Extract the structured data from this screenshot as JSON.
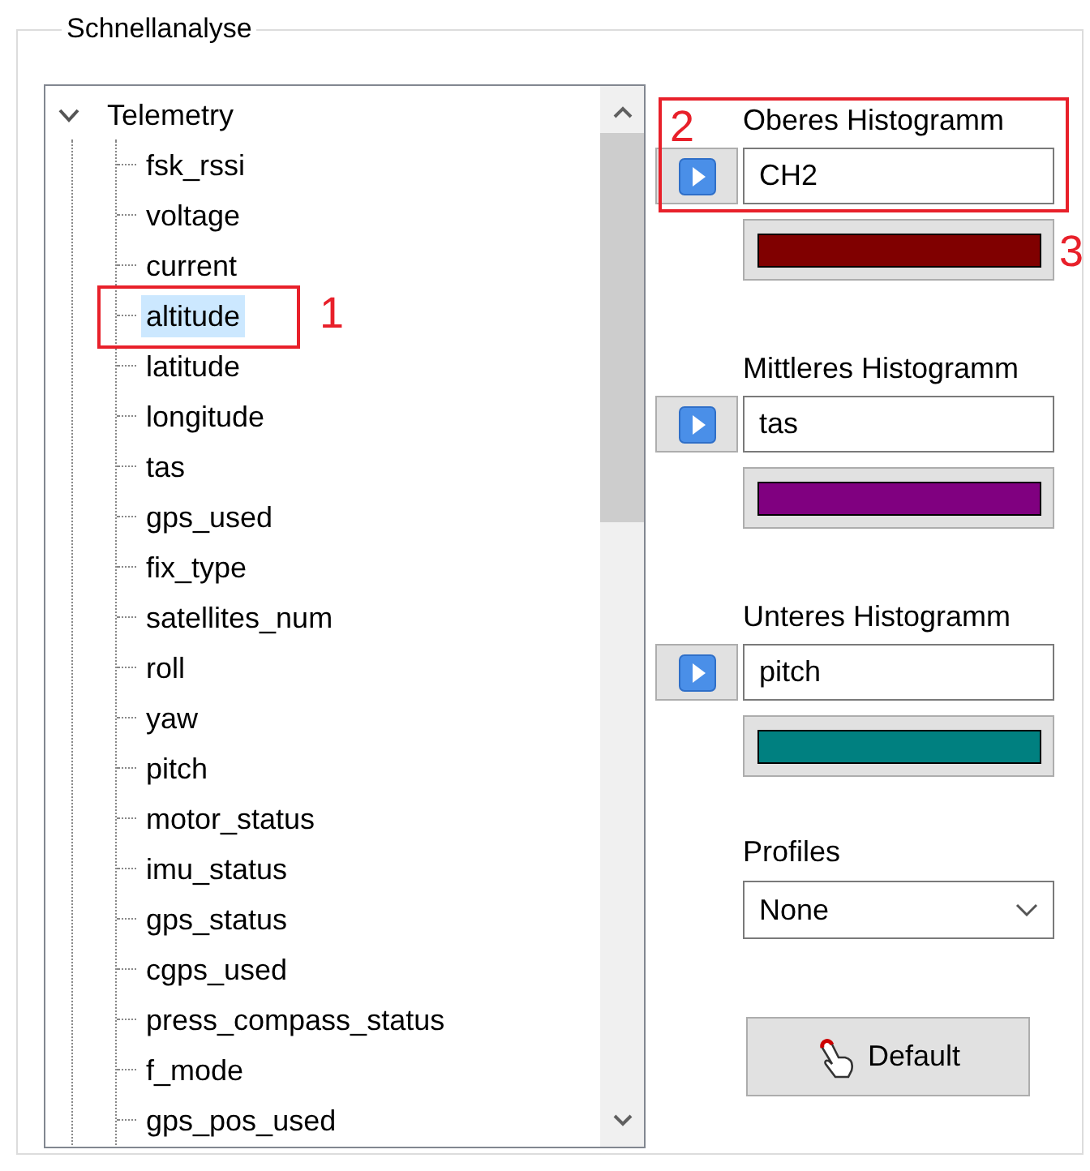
{
  "group_title": "Schnellanalyse",
  "tree": {
    "label": "Telemetry",
    "expanded": true,
    "children": [
      {
        "label": "fsk_rssi",
        "selected": false
      },
      {
        "label": "voltage",
        "selected": false
      },
      {
        "label": "current",
        "selected": false
      },
      {
        "label": "altitude",
        "selected": true
      },
      {
        "label": "latitude",
        "selected": false
      },
      {
        "label": "longitude",
        "selected": false
      },
      {
        "label": "tas",
        "selected": false
      },
      {
        "label": "gps_used",
        "selected": false
      },
      {
        "label": "fix_type",
        "selected": false
      },
      {
        "label": "satellites_num",
        "selected": false
      },
      {
        "label": "roll",
        "selected": false
      },
      {
        "label": "yaw",
        "selected": false
      },
      {
        "label": "pitch",
        "selected": false
      },
      {
        "label": "motor_status",
        "selected": false
      },
      {
        "label": "imu_status",
        "selected": false
      },
      {
        "label": "gps_status",
        "selected": false
      },
      {
        "label": "cgps_used",
        "selected": false
      },
      {
        "label": "press_compass_status",
        "selected": false
      },
      {
        "label": "f_mode",
        "selected": false
      },
      {
        "label": "gps_pos_used",
        "selected": false
      }
    ]
  },
  "histograms": [
    {
      "label": "Oberes Histogramm",
      "value": "CH2",
      "color": "#800000"
    },
    {
      "label": "Mittleres Histogramm",
      "value": "tas",
      "color": "#800080"
    },
    {
      "label": "Unteres Histogramm",
      "value": "pitch",
      "color": "#008080"
    }
  ],
  "profiles": {
    "label": "Profiles",
    "value": "None"
  },
  "default_button": "Default",
  "annotations": [
    {
      "number": "1"
    },
    {
      "number": "2"
    },
    {
      "number": "3"
    }
  ]
}
